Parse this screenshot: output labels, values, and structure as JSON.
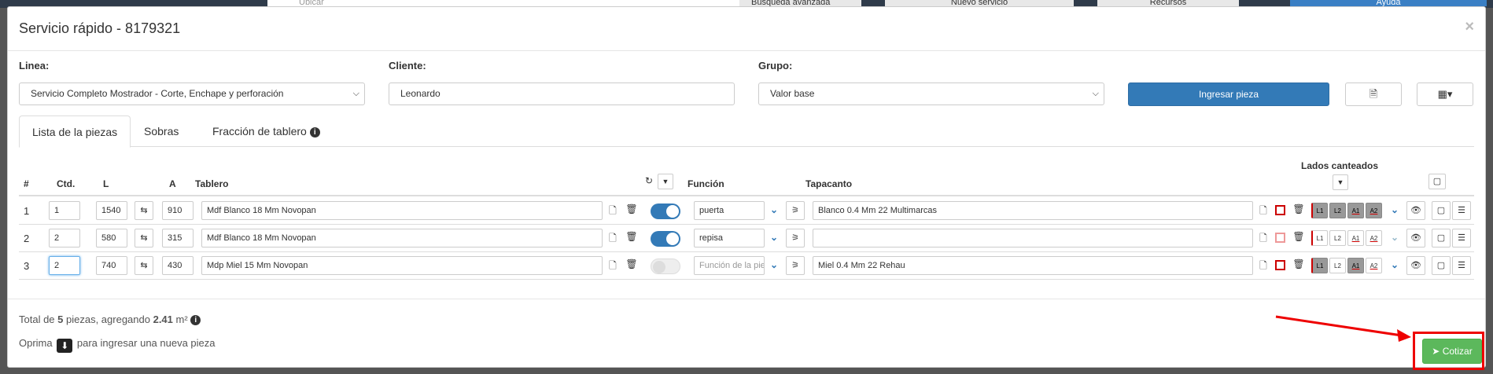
{
  "background": {
    "search_placeholder": "Ubicar",
    "advanced_search": "Búsqueda avanzada",
    "new_service": "Nuevo servicio",
    "resources": "Recursos",
    "help": "Ayuda"
  },
  "modal": {
    "title": "Servicio rápido - 8179321",
    "close": "×"
  },
  "form": {
    "linea_label": "Linea:",
    "linea_value": "Servicio Completo Mostrador - Corte, Enchape y perforación",
    "cliente_label": "Cliente:",
    "cliente_value": "Leonardo",
    "grupo_label": "Grupo:",
    "grupo_value": "Valor base",
    "ingresar_button": "Ingresar pieza"
  },
  "tabs": [
    {
      "label": "Lista de la piezas"
    },
    {
      "label": "Sobras"
    },
    {
      "label": "Fracción de tablero"
    }
  ],
  "table": {
    "headers": {
      "num": "#",
      "qty": "Ctd.",
      "l": "L",
      "a": "A",
      "tablero": "Tablero",
      "funcion": "Función",
      "tapacanto": "Tapacanto",
      "lados": "Lados canteados"
    },
    "side_labels": [
      "L1",
      "L2",
      "A1",
      "A2"
    ],
    "rows": [
      {
        "idx": "1",
        "qty": "1",
        "l": "1540",
        "a": "910",
        "tablero": "Mdf Blanco 18 Mm Novopan",
        "funcion": "puerta",
        "tapacanto": "Blanco 0.4 Mm 22 Multimarcas"
      },
      {
        "idx": "2",
        "qty": "2",
        "l": "580",
        "a": "315",
        "tablero": "Mdf Blanco 18 Mm Novopan",
        "funcion": "repisa",
        "tapacanto": ""
      },
      {
        "idx": "3",
        "qty": "2",
        "l": "740",
        "a": "430",
        "tablero": "Mdp Miel 15 Mm Novopan",
        "funcion": "",
        "funcion_placeholder": "Función de la pieza",
        "tapacanto": "Miel 0.4 Mm 22 Rehau"
      }
    ]
  },
  "footer": {
    "total_prefix": "Total de ",
    "total_count": "5",
    "total_middle": " piezas, agregando ",
    "total_area": "2.41",
    "total_unit": " m²",
    "hint_prefix": "Oprima",
    "hint_suffix": "para ingresar una nueva pieza",
    "cotizar_button": "Cotizar"
  },
  "colors": {
    "primary": "#337ab7",
    "success": "#5cb85c",
    "annotation": "#e00000"
  }
}
